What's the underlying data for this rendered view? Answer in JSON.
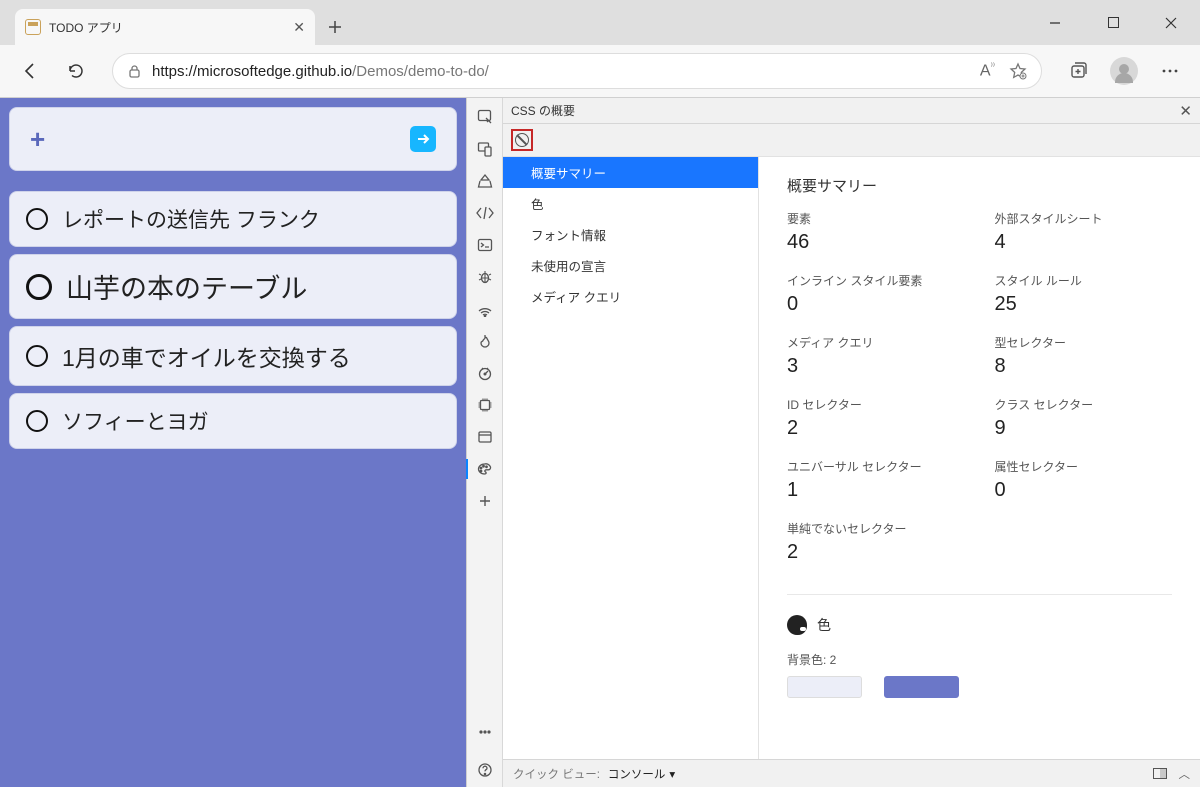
{
  "window": {
    "tab_title": "TODO アプリ",
    "url_host": "https://microsoftedge.github.io",
    "url_path": "/Demos/demo-to-do/"
  },
  "page": {
    "todos": [
      "レポートの送信先 フランク",
      "山芋の本のテーブル",
      "1月の車でオイルを交換する",
      "ソフィーとヨガ"
    ]
  },
  "devtools": {
    "panel_title": "CSS の概要",
    "sidebar": [
      "概要サマリー",
      "色",
      "フォント情報",
      "未使用の宣言",
      "メディア クエリ"
    ],
    "summary_heading": "概要サマリー",
    "stats": [
      {
        "label": "要素",
        "value": "46"
      },
      {
        "label": "外部スタイルシート",
        "value": "4"
      },
      {
        "label": "インライン スタイル要素",
        "value": "0"
      },
      {
        "label": "スタイル ルール",
        "value": "25"
      },
      {
        "label": "メディア クエリ",
        "value": "3"
      },
      {
        "label": "型セレクター",
        "value": "8"
      },
      {
        "label": "ID セレクター",
        "value": "2"
      },
      {
        "label": "クラス セレクター",
        "value": "9"
      },
      {
        "label": "ユニバーサル セレクター",
        "value": "1"
      },
      {
        "label": "属性セレクター",
        "value": "0"
      },
      {
        "label": "単純でないセレクター",
        "value": "2"
      }
    ],
    "colors_heading": "色",
    "bgcolor_label": "背景色: 2",
    "quickview_label": "クイック ビュー:",
    "quickview_value": "コンソール"
  }
}
